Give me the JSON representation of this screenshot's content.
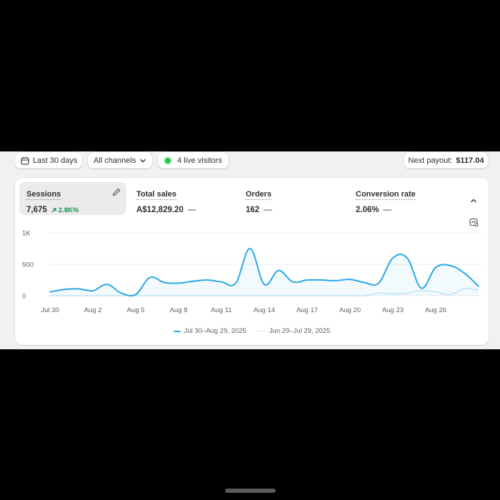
{
  "toolbar": {
    "date_range": "Last 30 days",
    "channels": "All channels",
    "live_visitors": "4 live visitors",
    "payout_label": "Next payout:",
    "payout_value": "$117.04"
  },
  "metrics": [
    {
      "label": "Sessions",
      "value": "7,675",
      "change": "2.8K%"
    },
    {
      "label": "Total sales",
      "value": "A$12,829.20",
      "dash": "—"
    },
    {
      "label": "Orders",
      "value": "162",
      "dash": "—"
    },
    {
      "label": "Conversion rate",
      "value": "2.06%",
      "dash": "—"
    }
  ],
  "icons": {
    "calendar": "calendar-icon",
    "chevron": "chevron-down-icon",
    "edit": "pencil-icon",
    "collapse": "chevron-up-icon",
    "chart_settings": "chart-settings-icon"
  },
  "colors": {
    "current_series": "#29a8e8",
    "previous_series": "#8fd3f5",
    "live_dot": "#1ec93e",
    "positive_change": "#1f8a52"
  },
  "chart_data": {
    "type": "area",
    "y_ticks": [
      "1K",
      "500",
      "0"
    ],
    "ylim": [
      0,
      1000
    ],
    "x_tick_labels": [
      "Jul 30",
      "Aug 2",
      "Aug 5",
      "Aug 8",
      "Aug 11",
      "Aug 14",
      "Aug 17",
      "Aug 20",
      "Aug 23",
      "Aug 26"
    ],
    "x_tick_index": [
      0,
      3,
      6,
      9,
      12,
      15,
      18,
      21,
      24,
      27
    ],
    "series": [
      {
        "name": "Jul 30–Aug 29, 2025",
        "style": "solid",
        "values": [
          60,
          100,
          110,
          80,
          180,
          40,
          20,
          290,
          210,
          200,
          230,
          250,
          220,
          200,
          750,
          180,
          400,
          220,
          250,
          250,
          240,
          260,
          210,
          200,
          600,
          600,
          120,
          450,
          480,
          360,
          150
        ]
      },
      {
        "name": "Jun 29–Jul 29, 2025",
        "style": "dotted",
        "values": [
          0,
          0,
          0,
          0,
          0,
          0,
          0,
          0,
          0,
          0,
          0,
          0,
          0,
          0,
          0,
          0,
          0,
          0,
          0,
          0,
          0,
          0,
          0,
          40,
          30,
          40,
          80,
          60,
          20,
          110,
          90
        ]
      }
    ],
    "legend": "bottom-center",
    "grid": true
  }
}
